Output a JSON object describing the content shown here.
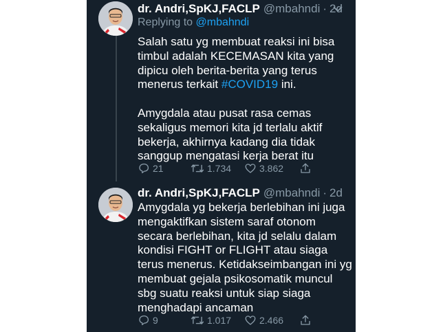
{
  "tweets": [
    {
      "name": "dr. Andri,SpKJ,FACLP",
      "handle": "@mbahndi",
      "separator": "·",
      "time": "2d",
      "replying_prefix": "Replying to",
      "replying_to": "@mbahndi",
      "text_part1": "Salah satu yg membuat reaksi ini bisa timbul adalah KECEMASAN kita yang dipicu oleh berita-berita yang terus menerus terkait ",
      "hashtag": "#COVID19",
      "text_part2": " ini.",
      "text_para2": "Amygdala atau pusat rasa cemas sekaligus memori kita jd terlalu aktif bekerja, akhirnya kadang dia tidak sanggup mengatasi kerja berat itu",
      "replies": "21",
      "retweets": "1.734",
      "likes": "3.862"
    },
    {
      "name": "dr. Andri,SpKJ,FACLP",
      "handle": "@mbahndi",
      "separator": "·",
      "time": "2d",
      "text": "Amygdala yg bekerja berlebihan ini juga mengaktifkan sistem saraf otonom secara berlebihan, kita jd selalu dalam kondisi FIGHT or FLIGHT atau siaga terus menerus. Ketidakseimbangan ini yg membuat gejala psikosomatik muncul sbg suatu reaksi untuk siap siaga menghadapi ancaman",
      "replies": "9",
      "retweets": "1.017",
      "likes": "2.466"
    }
  ],
  "icons": {
    "more": "chevron-down-icon",
    "reply": "reply-icon",
    "retweet": "retweet-icon",
    "like": "heart-icon",
    "share": "share-icon"
  },
  "colors": {
    "background": "#15202b",
    "text": "#ffffff",
    "muted": "#8899a6",
    "link": "#1da1f2",
    "thread_line": "#38444d"
  }
}
